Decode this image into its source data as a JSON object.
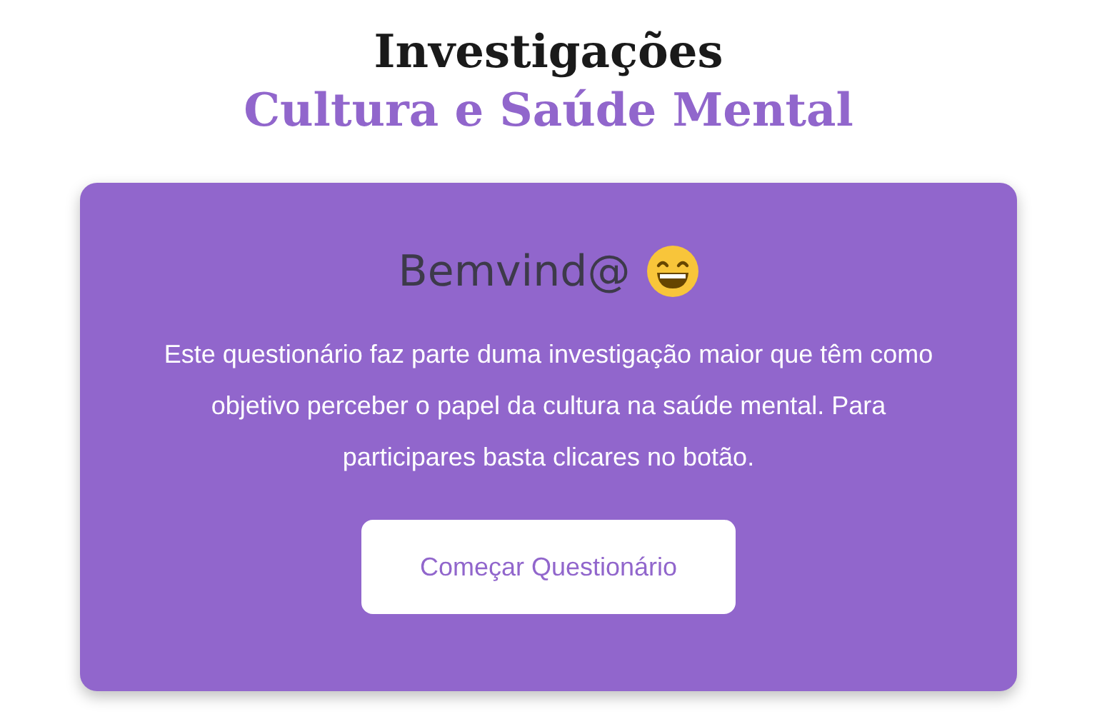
{
  "header": {
    "title": "Investigações",
    "subtitle": "Cultura e Saúde Mental"
  },
  "card": {
    "heading": "Bemvind@",
    "text": "Este questionário faz parte duma investigação maior que têm como objetivo perceber o papel da cultura na saúde mental. Para participares basta clicares no botão.",
    "button": "Começar Questionário"
  }
}
